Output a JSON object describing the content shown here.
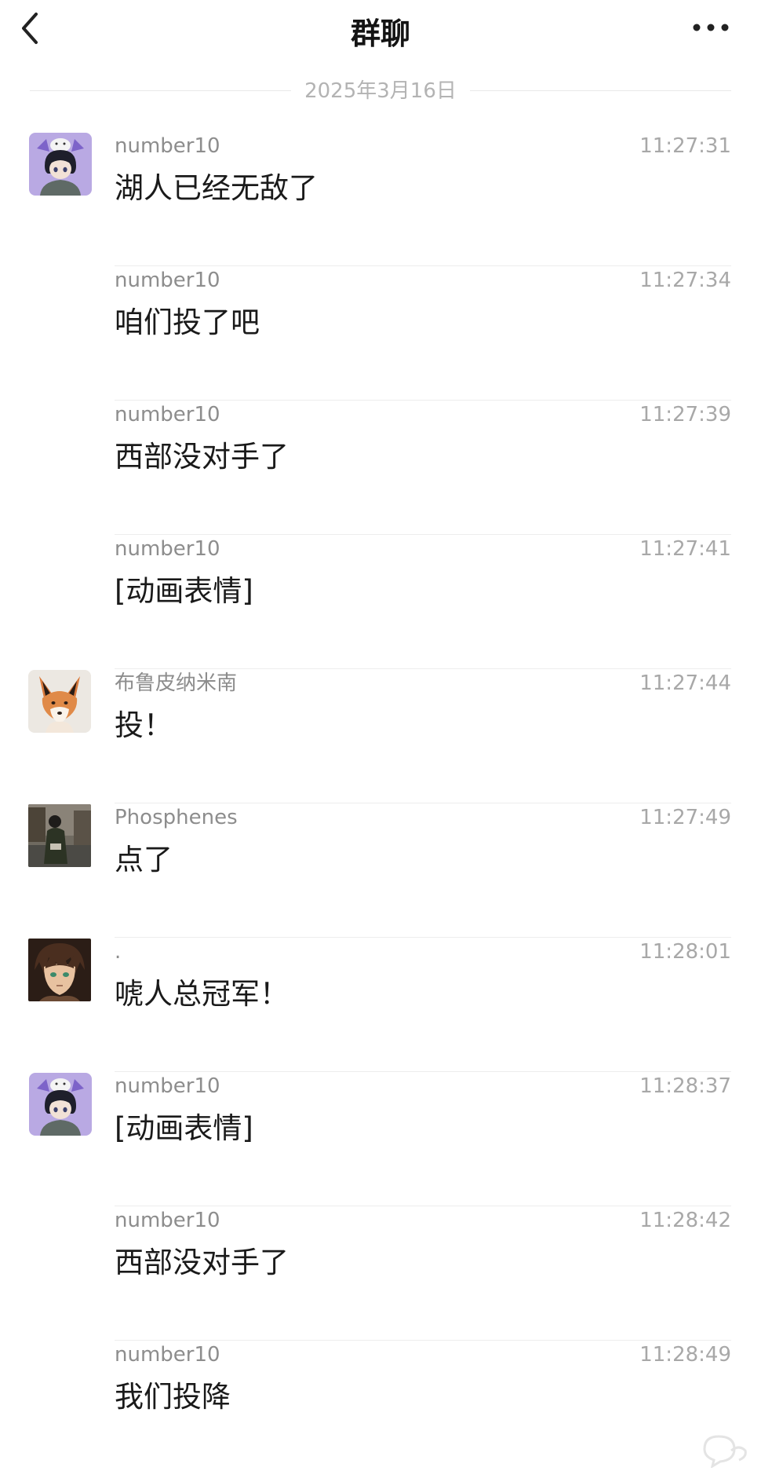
{
  "header": {
    "title": "群聊",
    "back_icon": "chevron-left-icon",
    "more_icon": "more-horizontal-icon"
  },
  "date_separator": "2025年3月16日",
  "messages": [
    {
      "name": "number10",
      "time": "11:27:31",
      "text": "湖人已经无敌了",
      "avatar": "anime-boy-cat-avatar"
    },
    {
      "name": "number10",
      "time": "11:27:34",
      "text": "咱们投了吧"
    },
    {
      "name": "number10",
      "time": "11:27:39",
      "text": "西部没对手了"
    },
    {
      "name": "number10",
      "time": "11:27:41",
      "text": "[动画表情]"
    },
    {
      "name": "布鲁皮纳米南",
      "time": "11:27:44",
      "text": "投！",
      "avatar": "fox-avatar"
    },
    {
      "name": "Phosphenes",
      "time": "11:27:49",
      "text": "点了",
      "avatar": "street-photo-avatar"
    },
    {
      "name": ".",
      "time": "11:28:01",
      "text": "唬人总冠军！",
      "avatar": "anime-character-avatar"
    },
    {
      "name": "number10",
      "time": "11:28:37",
      "text": "[动画表情]",
      "avatar": "anime-boy-cat-avatar"
    },
    {
      "name": "number10",
      "time": "11:28:42",
      "text": "西部没对手了"
    },
    {
      "name": "number10",
      "time": "11:28:49",
      "text": "我们投降"
    }
  ],
  "colors": {
    "name": "#8d8d8d",
    "time": "#a8a8a8",
    "divider": "#ededed",
    "text": "#1a1a1a"
  }
}
